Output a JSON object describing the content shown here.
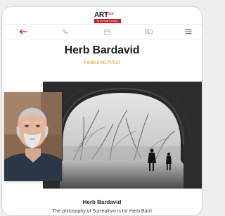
{
  "header": {
    "logo": {
      "art": "ART",
      "tour": "tour",
      "international": "INTERNATIONAL"
    }
  },
  "navbar": {
    "items": [
      {
        "icon": "back-arrow-icon",
        "color": "#c41b2f"
      },
      {
        "icon": "phone-icon"
      },
      {
        "icon": "calendar-icon"
      },
      {
        "icon": "search-icon"
      },
      {
        "icon": "menu-icon"
      }
    ]
  },
  "hero": {
    "title": "Herb Bardavid",
    "subtitle": "Featured Artist"
  },
  "caption": {
    "name": "Herb Bardavid",
    "line": "The philosophy of Surrealism is for Herb Bard"
  },
  "colors": {
    "accent": "#c41b2f",
    "subtitle": "#dba74a"
  }
}
